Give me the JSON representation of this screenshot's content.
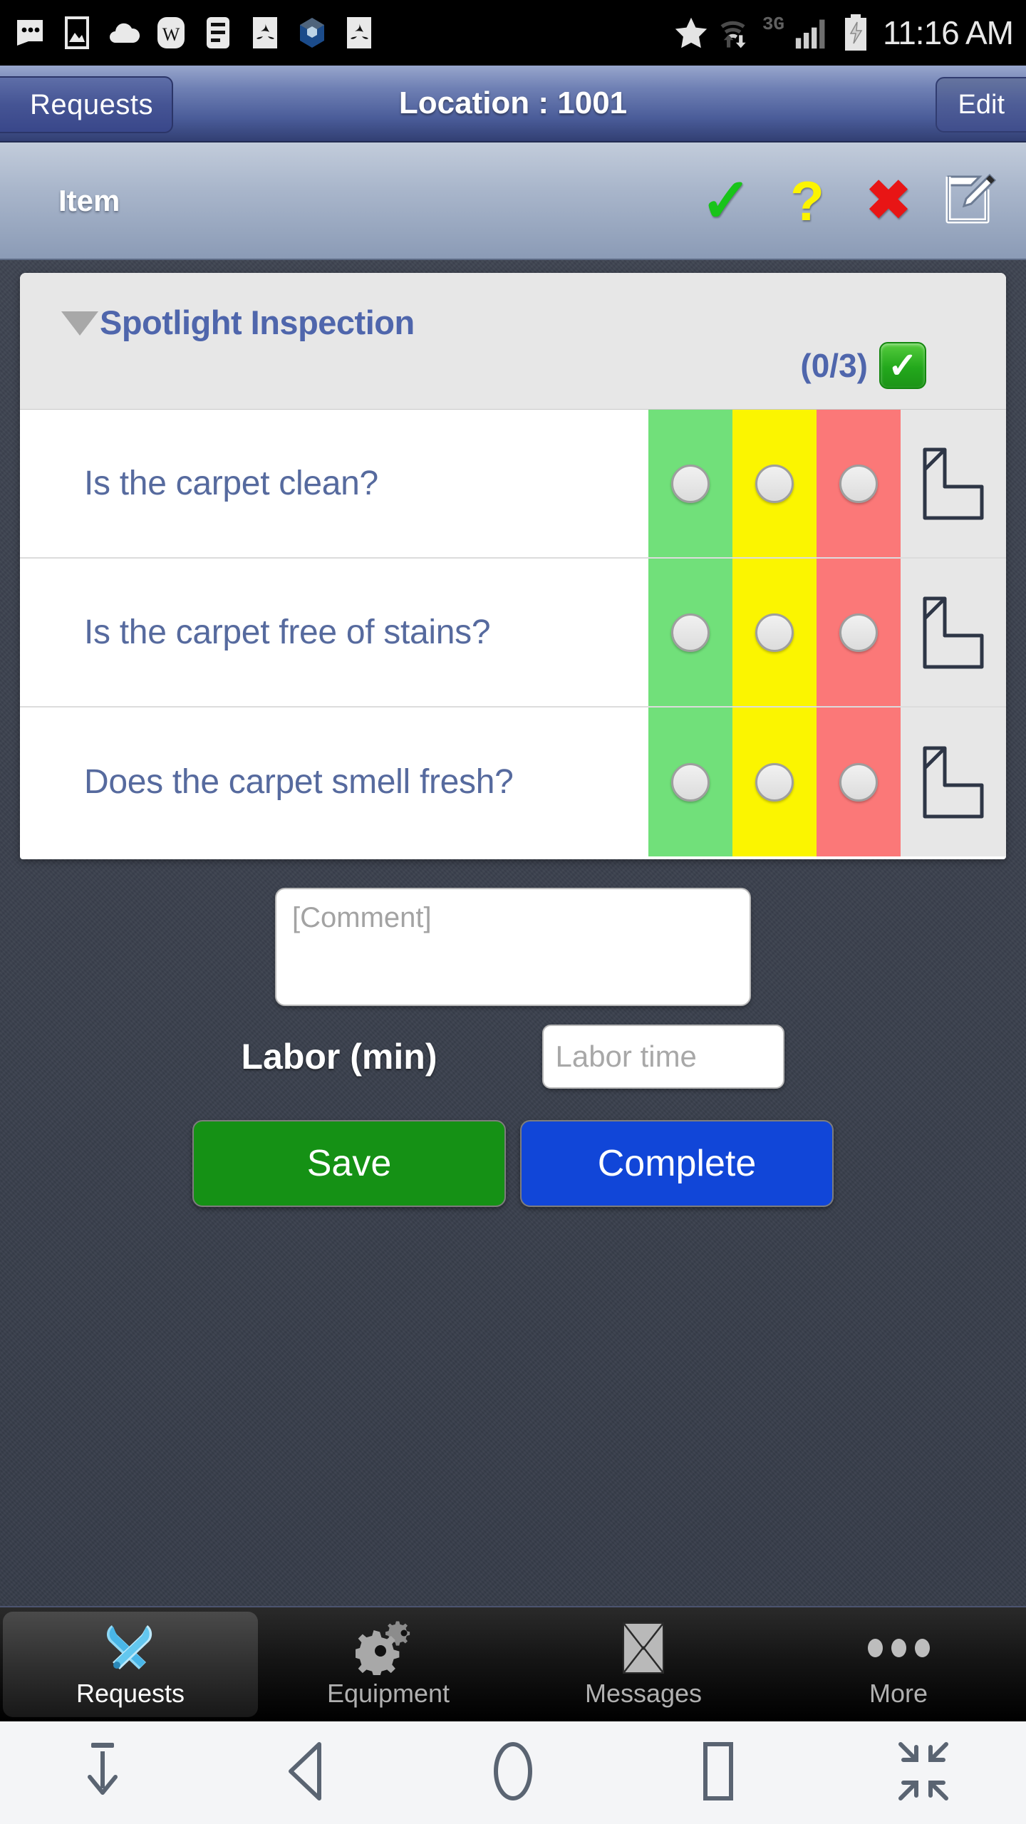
{
  "statusbar": {
    "time": "11:16 AM",
    "network_label": "3G",
    "left_icons": [
      "more-messages-icon",
      "gallery-icon",
      "cloud-upload-icon",
      "word-doc-icon",
      "list-doc-icon",
      "adobe-reader-icon",
      "app-badge-icon",
      "adobe-reader-icon-2"
    ],
    "right_icons": [
      "star-icon",
      "wifi-transfer-icon",
      "signal-bars-icon",
      "battery-charging-icon"
    ]
  },
  "navbar": {
    "back_label": "Requests",
    "title": "Location : 1001",
    "edit_label": "Edit"
  },
  "itembar": {
    "label": "Item",
    "actions": [
      {
        "name": "mark-pass",
        "glyph": "✓"
      },
      {
        "name": "mark-unknown",
        "glyph": "?"
      },
      {
        "name": "mark-fail",
        "glyph": "✖"
      },
      {
        "name": "edit-note",
        "glyph": ""
      }
    ]
  },
  "inspection": {
    "group_title": "Spotlight Inspection",
    "count_label": "(0/3)",
    "group_check_glyph": "✓",
    "questions": [
      {
        "text": "Is the carpet clean?"
      },
      {
        "text": "Is the carpet free of stains?"
      },
      {
        "text": "Does the carpet smell fresh?"
      }
    ],
    "option_colors": {
      "pass": "#71e07a",
      "unknown": "#fbf500",
      "fail": "#fb7878"
    }
  },
  "form": {
    "comment_placeholder": "[Comment]",
    "comment_value": "",
    "labor_label": "Labor (min)",
    "labor_placeholder": "Labor time",
    "labor_value": "",
    "save_label": "Save",
    "complete_label": "Complete",
    "save_color": "#159115",
    "complete_color": "#1146d8"
  },
  "tabbar": {
    "tabs": [
      {
        "label": "Requests",
        "icon": "tools-icon",
        "active": true
      },
      {
        "label": "Equipment",
        "icon": "gears-icon",
        "active": false
      },
      {
        "label": "Messages",
        "icon": "envelope-icon",
        "active": false
      },
      {
        "label": "More",
        "icon": "ellipsis-icon",
        "active": false
      }
    ]
  },
  "androidnav": {
    "buttons": [
      "hide-keyboard-icon",
      "back-icon",
      "home-icon",
      "recents-icon",
      "shrink-screen-icon"
    ]
  }
}
